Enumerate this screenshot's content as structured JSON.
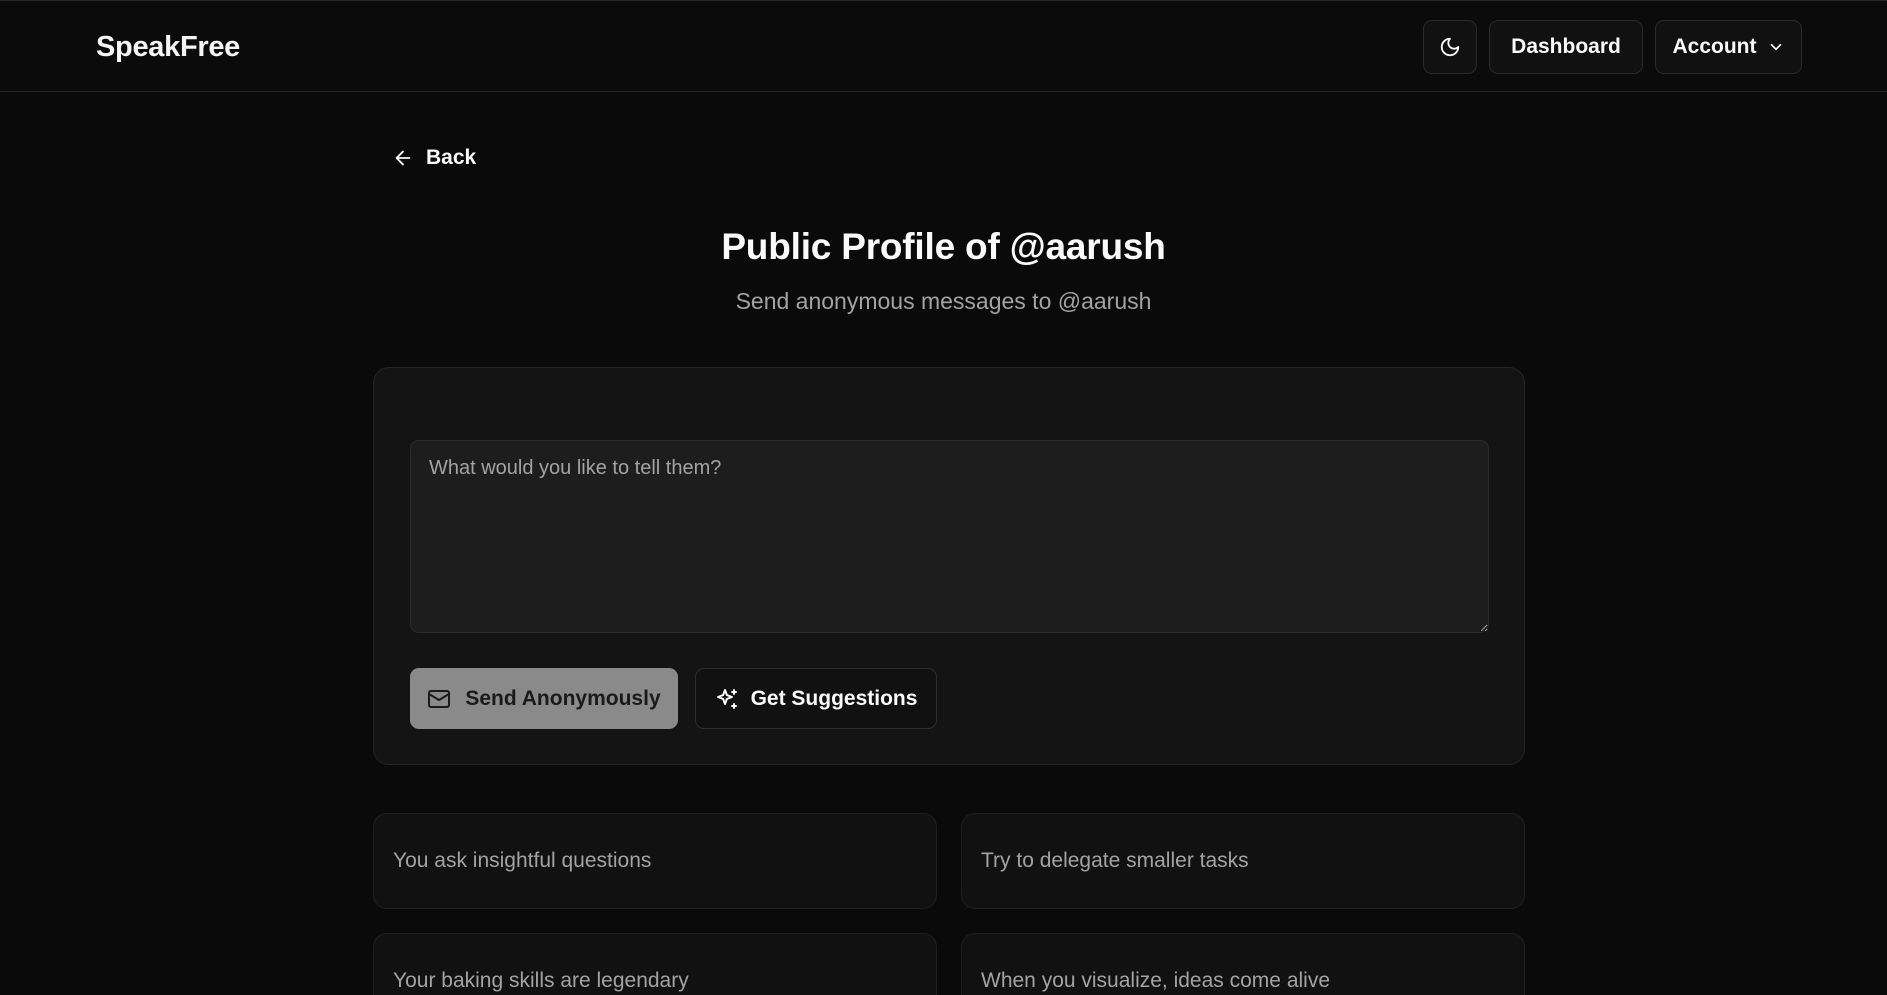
{
  "header": {
    "brand": "SpeakFree",
    "theme_icon": "moon-icon",
    "dashboard_label": "Dashboard",
    "account_label": "Account",
    "account_icon": "chevron-down-icon"
  },
  "back": {
    "label": "Back",
    "icon": "arrow-left-icon"
  },
  "page": {
    "title": "Public Profile of @aarush",
    "subtitle": "Send anonymous messages to @aarush"
  },
  "form": {
    "message_value": "",
    "message_placeholder": "What would you like to tell them?",
    "send_label": "Send Anonymously",
    "send_icon": "mail-icon",
    "suggestions_label": "Get Suggestions",
    "suggestions_icon": "sparkles-icon"
  },
  "suggestions": [
    "You ask insightful questions",
    "Try to delegate smaller tasks",
    "Your baking skills are legendary",
    "When you visualize, ideas come alive"
  ],
  "colors": {
    "background": "#0a0a0a",
    "card": "#141414",
    "send_button": "#8a8a8a",
    "muted_text": "#a3a3a3"
  }
}
